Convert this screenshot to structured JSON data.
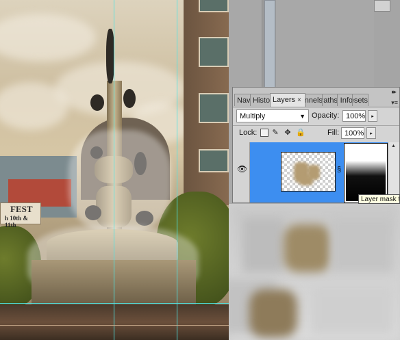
{
  "canvas": {
    "banner_line1": "FEST",
    "banner_line2": "h 10th & 11th",
    "image_desc_colors": {
      "sky": "#d6c6a5",
      "water": "#ffffff",
      "building": "#876a50"
    }
  },
  "layers_panel": {
    "tabs": [
      {
        "label": "Navigator",
        "active": false
      },
      {
        "label": "Histogram",
        "active": false
      },
      {
        "label": "Layers",
        "active": true
      },
      {
        "label": "Channels",
        "active": false
      },
      {
        "label": "Paths",
        "active": false
      },
      {
        "label": "Info",
        "active": false
      },
      {
        "label": "Presets",
        "active": false
      }
    ],
    "close_glyph": "×",
    "collapse_glyph": "▸▸",
    "menu_glyph": "▾≡",
    "blend_mode": "Multiply",
    "opacity_label": "Opacity:",
    "opacity_value": "100%",
    "lock_label": "Lock:",
    "fill_label": "Fill:",
    "fill_value": "100%",
    "step_glyph": "▸",
    "dropdown_glyph": "▼",
    "eye_glyph": "👁",
    "chain_glyph": "🔗",
    "scroll_up_glyph": "▲",
    "tooltip": "Layer mask thumbnail",
    "selected_color": "#3d8ef0"
  },
  "icons": {
    "lock_transparent": "transparency-lock-icon",
    "lock_brush": "brush-lock-icon",
    "lock_move": "move-lock-icon",
    "lock_all": "padlock-icon"
  }
}
